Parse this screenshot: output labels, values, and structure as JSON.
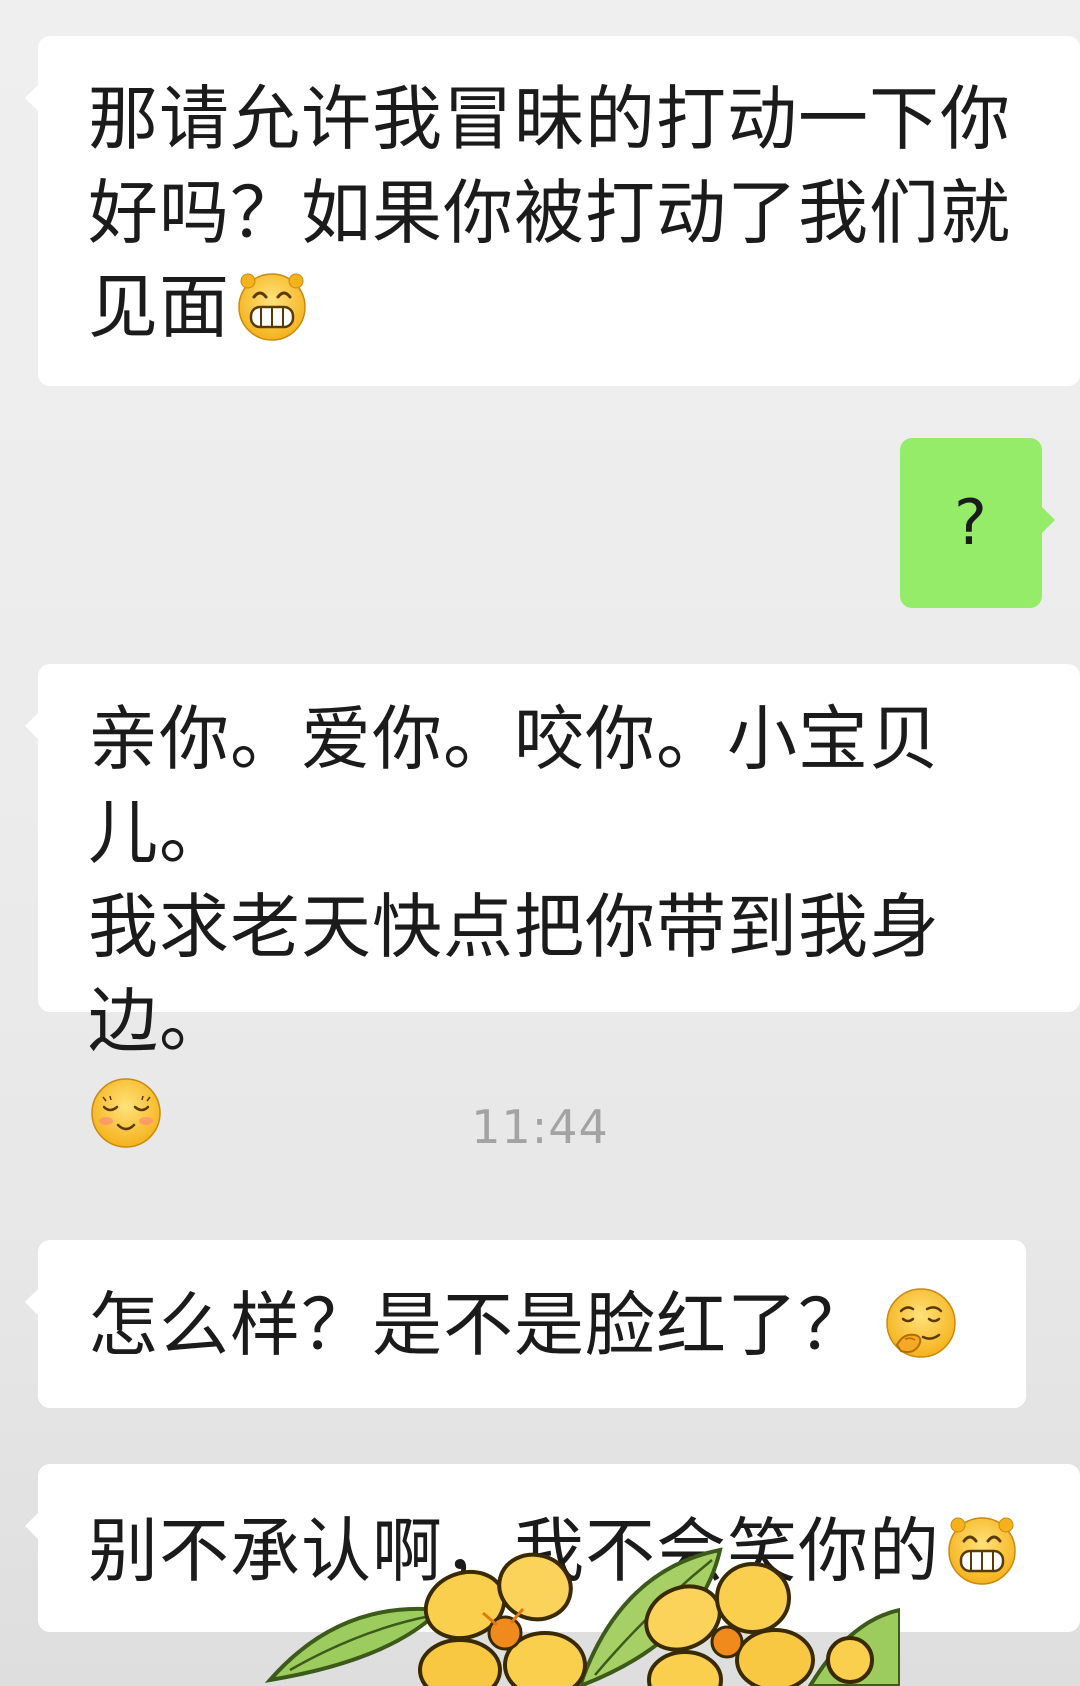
{
  "messages": [
    {
      "direction": "incoming",
      "lines": [
        "那请允许我冒昧的打动一下你",
        "好吗？如果你被打动了我们就",
        "见面"
      ],
      "emoji": "grin-face-icon"
    },
    {
      "direction": "outgoing",
      "text": "?"
    },
    {
      "direction": "incoming",
      "lines": [
        "亲你。爱你。咬你。小宝贝儿。",
        "我求老天快点把你带到我身边。"
      ],
      "emoji": "shy-smile-face-icon"
    },
    {
      "direction": "incoming",
      "lines": [
        "怎么样？是不是脸红了？"
      ],
      "emoji": "smirk-hand-face-icon"
    },
    {
      "direction": "incoming",
      "lines": [
        "别不承认啊，我不会笑你的"
      ],
      "emoji": "grin-face-icon"
    }
  ],
  "timestamp": "11:44",
  "sticker": "osmanthus-flower-sticker",
  "colors": {
    "incoming_bubble": "#ffffff",
    "outgoing_bubble": "#95ec69",
    "background": "#ededed",
    "timestamp": "#a3a3a3"
  }
}
